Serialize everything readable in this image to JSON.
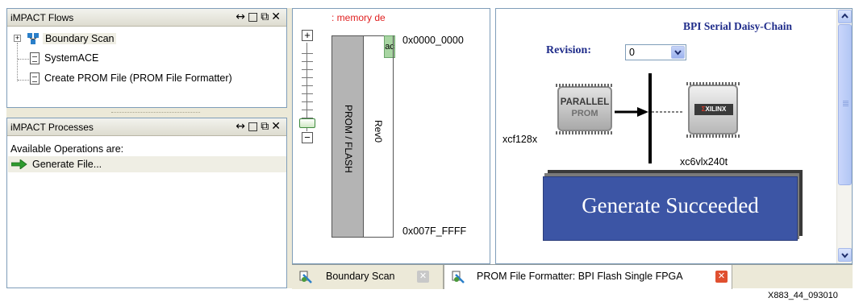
{
  "flows_panel": {
    "title": "iMPACT Flows",
    "controls": "↔ □ &#x1f5d7; ✕",
    "items": [
      {
        "label": "Boundary Scan",
        "selected": true,
        "icon": "chain-icon"
      },
      {
        "label": "SystemACE",
        "icon": "document-icon"
      },
      {
        "label": "Create PROM File (PROM File Formatter)",
        "icon": "document-icon"
      }
    ]
  },
  "processes_panel": {
    "title": "iMPACT Processes",
    "heading": "Available Operations are:",
    "items": [
      {
        "label": "Generate File...",
        "icon": "green-arrow-icon"
      }
    ]
  },
  "memory_view": {
    "header": ": memory de",
    "prom_label": "PROM / FLASH",
    "rev_label": "Rev0",
    "ac_label": "ac",
    "start_address": "0x0000_0000",
    "end_address": "0x007F_FFFF",
    "zoom_in": "+",
    "zoom_out": "−"
  },
  "bpi_view": {
    "title": "BPI Serial Daisy-Chain",
    "revision_label": "Revision:",
    "revision_value": "0",
    "prom_chip_line1": "PARALLEL",
    "prom_chip_line2": "PROM",
    "prom_part": "xcf128x",
    "fpga_chip_label": "XILINX",
    "fpga_part": "xc6vlx240t",
    "status_message": "Generate Succeeded"
  },
  "tabs": [
    {
      "label": "Boundary Scan",
      "active": false
    },
    {
      "label": "PROM File Formatter: BPI Flash Single FPGA",
      "active": true
    }
  ],
  "figure_id": "X883_44_093010",
  "colors": {
    "title_blue": "#1f2c8a",
    "banner_blue": "#3c55a5",
    "prom_gray": "#b4b4b4",
    "ac_green": "#a8d5a2",
    "close_red": "#e05030",
    "memory_red": "#e02020"
  }
}
